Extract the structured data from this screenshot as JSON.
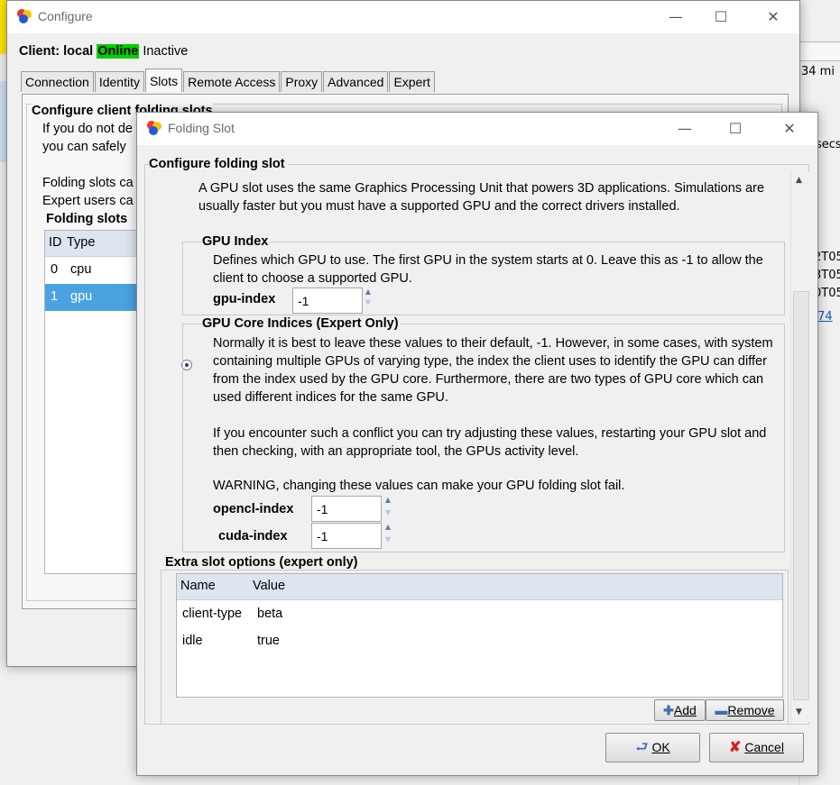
{
  "background": {
    "right_texts": [
      "34 mi",
      "secs",
      "2T05",
      "3T05",
      "0T05",
      ".74"
    ]
  },
  "configure": {
    "title": "Configure",
    "client_label": "Client:",
    "client_name": "local",
    "status_online": "Online",
    "status_inactive": "Inactive",
    "tabs": [
      "Connection",
      "Identity",
      "Slots",
      "Remote Access",
      "Proxy",
      "Advanced",
      "Expert"
    ],
    "active_tab": "Slots",
    "section_title": "Configure client folding slots",
    "desc_line1": "If you do not de",
    "desc_line2": "you can safely",
    "desc_line3": "Folding slots ca",
    "desc_line4": "Expert users ca",
    "slots_title": "Folding slots",
    "table_headers": [
      "ID",
      "Type"
    ],
    "rows": [
      {
        "id": "0",
        "type": "cpu"
      },
      {
        "id": "1",
        "type": "gpu"
      }
    ]
  },
  "slot_dialog": {
    "title": "Folding Slot",
    "section_title": "Configure folding slot",
    "gpu_desc": "A GPU slot uses the same Graphics Processing Unit that powers 3D applications. Simulations are usually faster but you must have a supported GPU and the correct drivers installed.",
    "gpu_index_title": "GPU Index",
    "gpu_index_desc": "Defines which GPU to use.  The first GPU in the system starts at 0.  Leave this as -1 to allow the client to choose a supported GPU.",
    "gpu_index_label": "gpu-index",
    "gpu_index_value": "-1",
    "core_title": "GPU Core Indices (Expert Only)",
    "core_desc1": "Normally it is best to leave these values to their default, -1.  However, in some cases, with system containing multiple GPUs of varying type, the index the client uses to identify the GPU can differ from the index used by the GPU core.  Furthermore, there are two types of GPU core which can used different indices for the same GPU.",
    "core_desc2": "If you encounter such a conflict you can try adjusting these values, restarting your GPU slot and then checking, with an appropriate tool, the GPUs activity level.",
    "core_warning": "WARNING, changing these values can make your GPU folding slot fail.",
    "opencl_label": "opencl-index",
    "opencl_value": "-1",
    "cuda_label": "cuda-index",
    "cuda_value": "-1",
    "extra_title": "Extra slot options (expert only)",
    "extra_headers": [
      "Name",
      "Value"
    ],
    "extra_rows": [
      {
        "name": "client-type",
        "value": "beta"
      },
      {
        "name": "idle",
        "value": "true"
      }
    ],
    "add_label": "Add",
    "remove_label": "Remove",
    "ok_label": "OK",
    "cancel_label": "Cancel"
  },
  "colors": {
    "online_bg": "#00d000",
    "selection": "#4aa3e0",
    "header_bg": "#dde6f0"
  }
}
